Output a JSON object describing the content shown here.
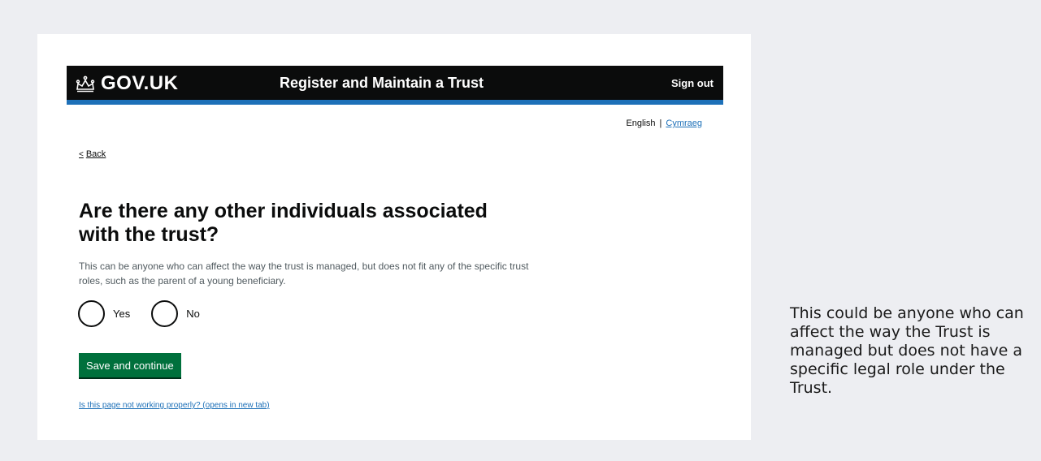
{
  "header": {
    "logo_text": "GOV.UK",
    "service_name": "Register and Maintain a Trust",
    "sign_out": "Sign out"
  },
  "language": {
    "current": "English",
    "separator": "|",
    "alternate": "Cymraeg"
  },
  "nav": {
    "back_chevron": "<",
    "back_label": "Back"
  },
  "question": {
    "heading": "Are there any other individuals associated with the trust?",
    "hint": "This can be anyone who can affect the way the trust is managed, but does not fit any of the specific trust roles, such as the parent of a young beneficiary.",
    "options": [
      {
        "label": "Yes"
      },
      {
        "label": "No"
      }
    ]
  },
  "actions": {
    "save_label": "Save and continue"
  },
  "footer": {
    "report_link": "Is this page not working properly? (opens in new tab)"
  },
  "side_note": {
    "text": "This could be anyone who can affect the way the Trust is managed but does not have a specific legal role under the Trust."
  },
  "colors": {
    "header_bg": "#0b0c0c",
    "header_stripe": "#1d70b8",
    "link": "#1d70b8",
    "button": "#00703c",
    "page_bg": "#edeef2"
  },
  "icons": {
    "logo": "crown-icon"
  }
}
